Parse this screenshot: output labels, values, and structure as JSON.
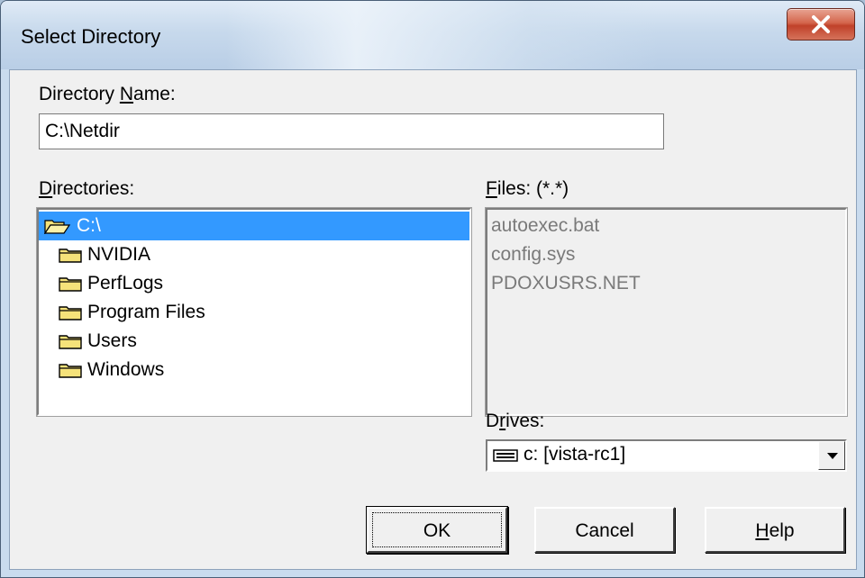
{
  "window": {
    "title": "Select Directory",
    "close_label": "x"
  },
  "directory_name": {
    "label_pre": "Directory ",
    "label_hotkey": "N",
    "label_post": "ame:",
    "value": "C:\\Netdir"
  },
  "directories": {
    "label_hotkey": "D",
    "label_post": "irectories:",
    "items": [
      {
        "label": "C:\\",
        "icon": "open-folder-icon",
        "selected": true
      },
      {
        "label": "NVIDIA",
        "icon": "folder-icon"
      },
      {
        "label": "PerfLogs",
        "icon": "folder-icon"
      },
      {
        "label": "Program Files",
        "icon": "folder-icon"
      },
      {
        "label": "Users",
        "icon": "folder-icon"
      },
      {
        "label": "Windows",
        "icon": "folder-icon"
      }
    ]
  },
  "files": {
    "label_hotkey": "F",
    "label_post": "iles: (*.*)",
    "items": [
      "autoexec.bat",
      "config.sys",
      "PDOXUSRS.NET"
    ]
  },
  "drives": {
    "label_pre": "D",
    "label_hotkey": "r",
    "label_post": "ives:",
    "selected": "c: [vista-rc1]",
    "icon": "drive-icon"
  },
  "buttons": {
    "ok": "OK",
    "cancel": "Cancel",
    "help_hotkey": "H",
    "help_post": "elp"
  },
  "colors": {
    "selection": "#3399ff",
    "folder": "#f5e27a",
    "dialog_bg": "#f0f0f0"
  }
}
